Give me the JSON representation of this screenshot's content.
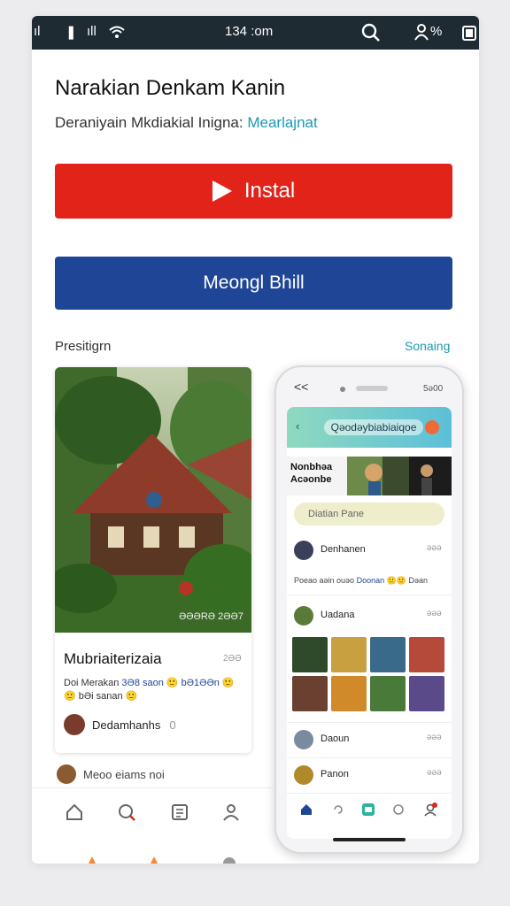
{
  "status_bar": {
    "signal": "ıl",
    "notification": "❚",
    "bars": "ıll",
    "wifi": "wifi-icon",
    "time": "134 :om",
    "search": "search-icon",
    "battery_pct": "%",
    "battery": "battery-icon"
  },
  "app": {
    "title": "Narakian Denkam Kanin",
    "subtitle_prefix": "Deraniyain Mkdiakial Inigna:",
    "subtitle_accent": "Mearlajnat"
  },
  "buttons": {
    "install_label": "Instal",
    "secondary_label": "Meongl Bhill"
  },
  "section": {
    "label": "Presitigrn",
    "link": "Sonaing"
  },
  "screenshot_1": {
    "photo_tag": "ƏƏƏRƏ 2ƏƏ7",
    "post_title": "Mubriaiterizaia",
    "post_meta": "2ƏƏ",
    "post_text_a": "Doi Merakan ",
    "post_text_hl": "3Ə8 saon",
    "post_text_b": " 🙂 ",
    "post_text_c": "bƏ1ƏƏn",
    "post_text_d": " 🙂🙂 bƏi sanan 🙂",
    "author_name": "Dedamhanhs",
    "author_count": "0",
    "behind_row": "Meoo eiams noi",
    "nav": [
      "home-icon",
      "chat-icon",
      "document-icon",
      "profile-icon"
    ]
  },
  "phone": {
    "back": "<<",
    "time": "5ə00",
    "header_back": "‹",
    "header_title": "Qəodəybiabiaiqoe",
    "banner_text": "Nonbhəa Acəonbe",
    "search_placeholder": "Diatian Pane",
    "feed": [
      {
        "name": "Denhanen",
        "dots": "əəə"
      },
      {
        "name": "Uadana",
        "dots": "əəə"
      },
      {
        "name": "Daoun",
        "dots": "əəə"
      },
      {
        "name": "Panon",
        "dots": "əəə"
      }
    ],
    "feed_sub_a": "Poeao aəin ouəo ",
    "feed_sub_hl": "Doonan",
    "feed_sub_b": " 🙂🙂 Dəan",
    "nav": [
      "home-icon",
      "refresh-icon",
      "shop-icon",
      "loop-icon",
      "profile-icon"
    ]
  },
  "colors": {
    "install": "#e2231a",
    "secondary": "#1f4596",
    "accent": "#1a9ab0"
  }
}
